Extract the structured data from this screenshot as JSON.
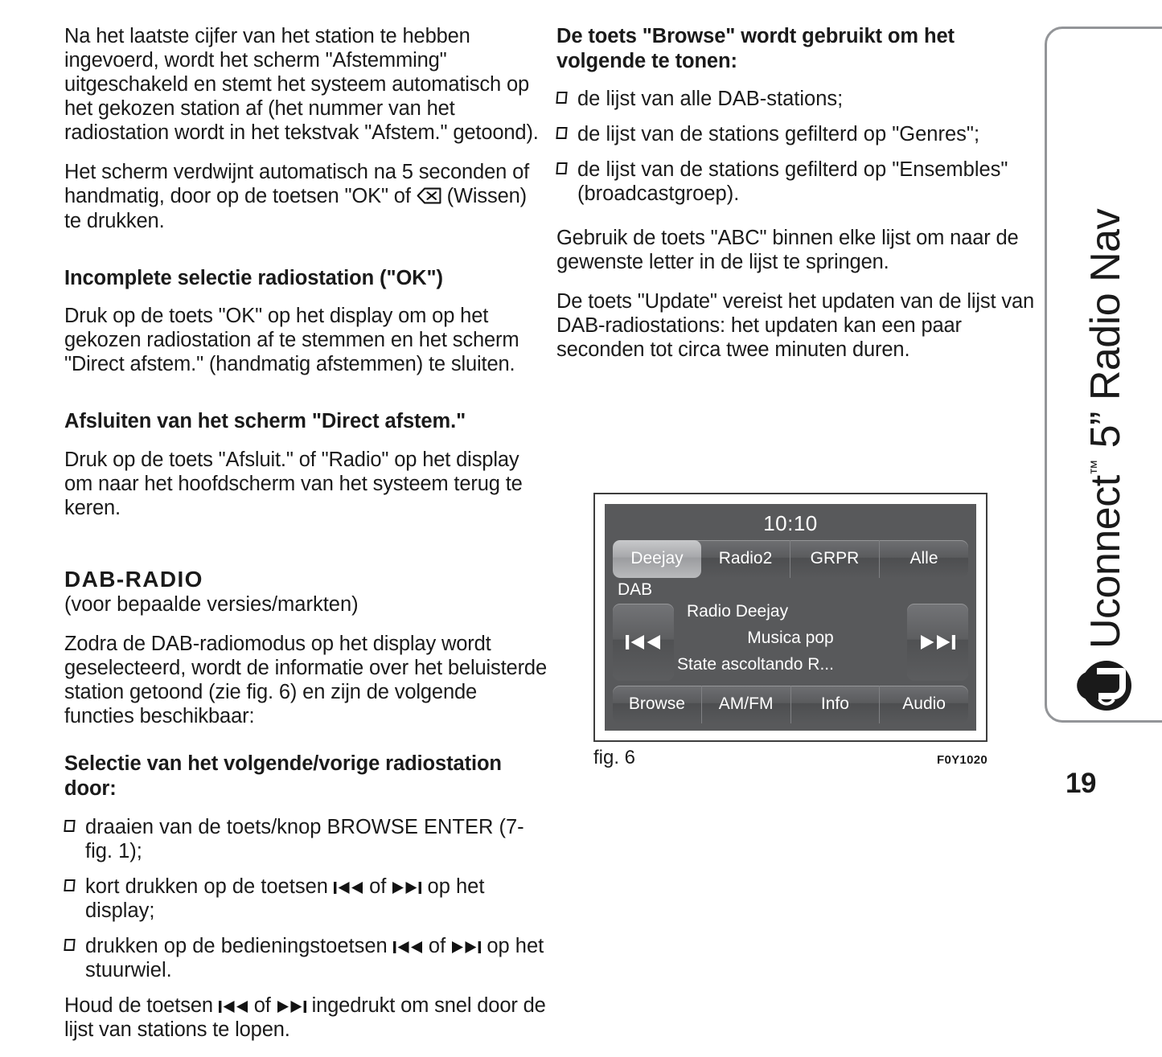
{
  "left_column": {
    "paragraph_1": "Na het laatste cijfer van het station te hebben ingevoerd, wordt het scherm \"Afstemming\" uitgeschakeld en stemt het systeem automatisch op het gekozen station af (het nummer van het radiostation wordt in het tekstvak \"Afstem.\" getoond).",
    "paragraph_2_before_icon": "Het scherm verdwijnt automatisch na 5 seconden of handmatig, door op de toetsen \"OK\" of ",
    "paragraph_2_after_icon": " (Wissen) te drukken.",
    "heading_1": "Incomplete selectie radiostation (\"OK\")",
    "paragraph_3": "Druk op de toets \"OK\" op het display om op het gekozen radiostation af te stemmen en het scherm \"Direct afstem.\" (handmatig afstemmen) te sluiten.",
    "heading_2": "Afsluiten van het scherm \"Direct afstem.\"",
    "paragraph_4": "Druk op de toets \"Afsluit.\" of \"Radio\" op het display om naar het hoofdscherm van het systeem terug te keren.",
    "chapter_heading": "DAB-RADIO",
    "chapter_note": "(voor bepaalde versies/markten)",
    "paragraph_5": "Zodra de DAB-radiomodus op het display wordt geselecteerd, wordt de informatie over het beluisterde station getoond (zie fig. 6) en zijn de volgende functies beschikbaar:",
    "heading_3": "Selectie van het volgende/vorige radiostation door:",
    "bullet_1": "draaien van de toets/knop BROWSE ENTER (7-fig. 1);",
    "bullet_2_a": "kort drukken op de toetsen ",
    "bullet_2_b": " of ",
    "bullet_2_c": " op het display;",
    "bullet_3_a": "drukken op de bedieningstoetsen ",
    "bullet_3_b": " of ",
    "bullet_3_c": " op het stuurwiel.",
    "paragraph_6_a": "Houd de toetsen ",
    "paragraph_6_b": " of ",
    "paragraph_6_c": " ingedrukt om snel door de lijst van stations te lopen."
  },
  "right_column": {
    "heading_1": "De toets \"Browse\" wordt gebruikt om het volgende te tonen:",
    "bullet_1": "de lijst van alle DAB-stations;",
    "bullet_2": "de lijst van de stations gefilterd op \"Genres\";",
    "bullet_3": "de lijst van de stations gefilterd op \"Ensembles\" (broadcastgroep).",
    "paragraph_1": "Gebruik de toets \"ABC\" binnen elke lijst om naar de gewenste letter in de lijst te springen.",
    "paragraph_2": "De toets \"Update\" vereist het updaten van de lijst van DAB-radiostations: het updaten kan een paar seconden tot circa twee minuten duren."
  },
  "figure": {
    "caption": "fig. 6",
    "code": "F0Y1020",
    "screen": {
      "clock": "10:10",
      "preset_buttons": [
        "Deejay",
        "Radio2",
        "GRPR",
        "Alle"
      ],
      "active_preset": "Deejay",
      "band_label": "DAB",
      "prev_icon": "previous-track-icon",
      "next_icon": "next-track-icon",
      "info_line_1": "Radio Deejay",
      "info_line_2": "Musica pop",
      "info_line_3": "State ascoltando R...",
      "bottom_buttons": [
        "Browse",
        "AM/FM",
        "Info",
        "Audio"
      ]
    }
  },
  "side_tab": {
    "brand": "Uconnect",
    "trademark": "™",
    "title": " 5” Radio Nav"
  },
  "page_number": "19",
  "colors": {
    "screen_bg": "#58595b",
    "tab_border": "#939598",
    "text": "#1a1a1a"
  }
}
